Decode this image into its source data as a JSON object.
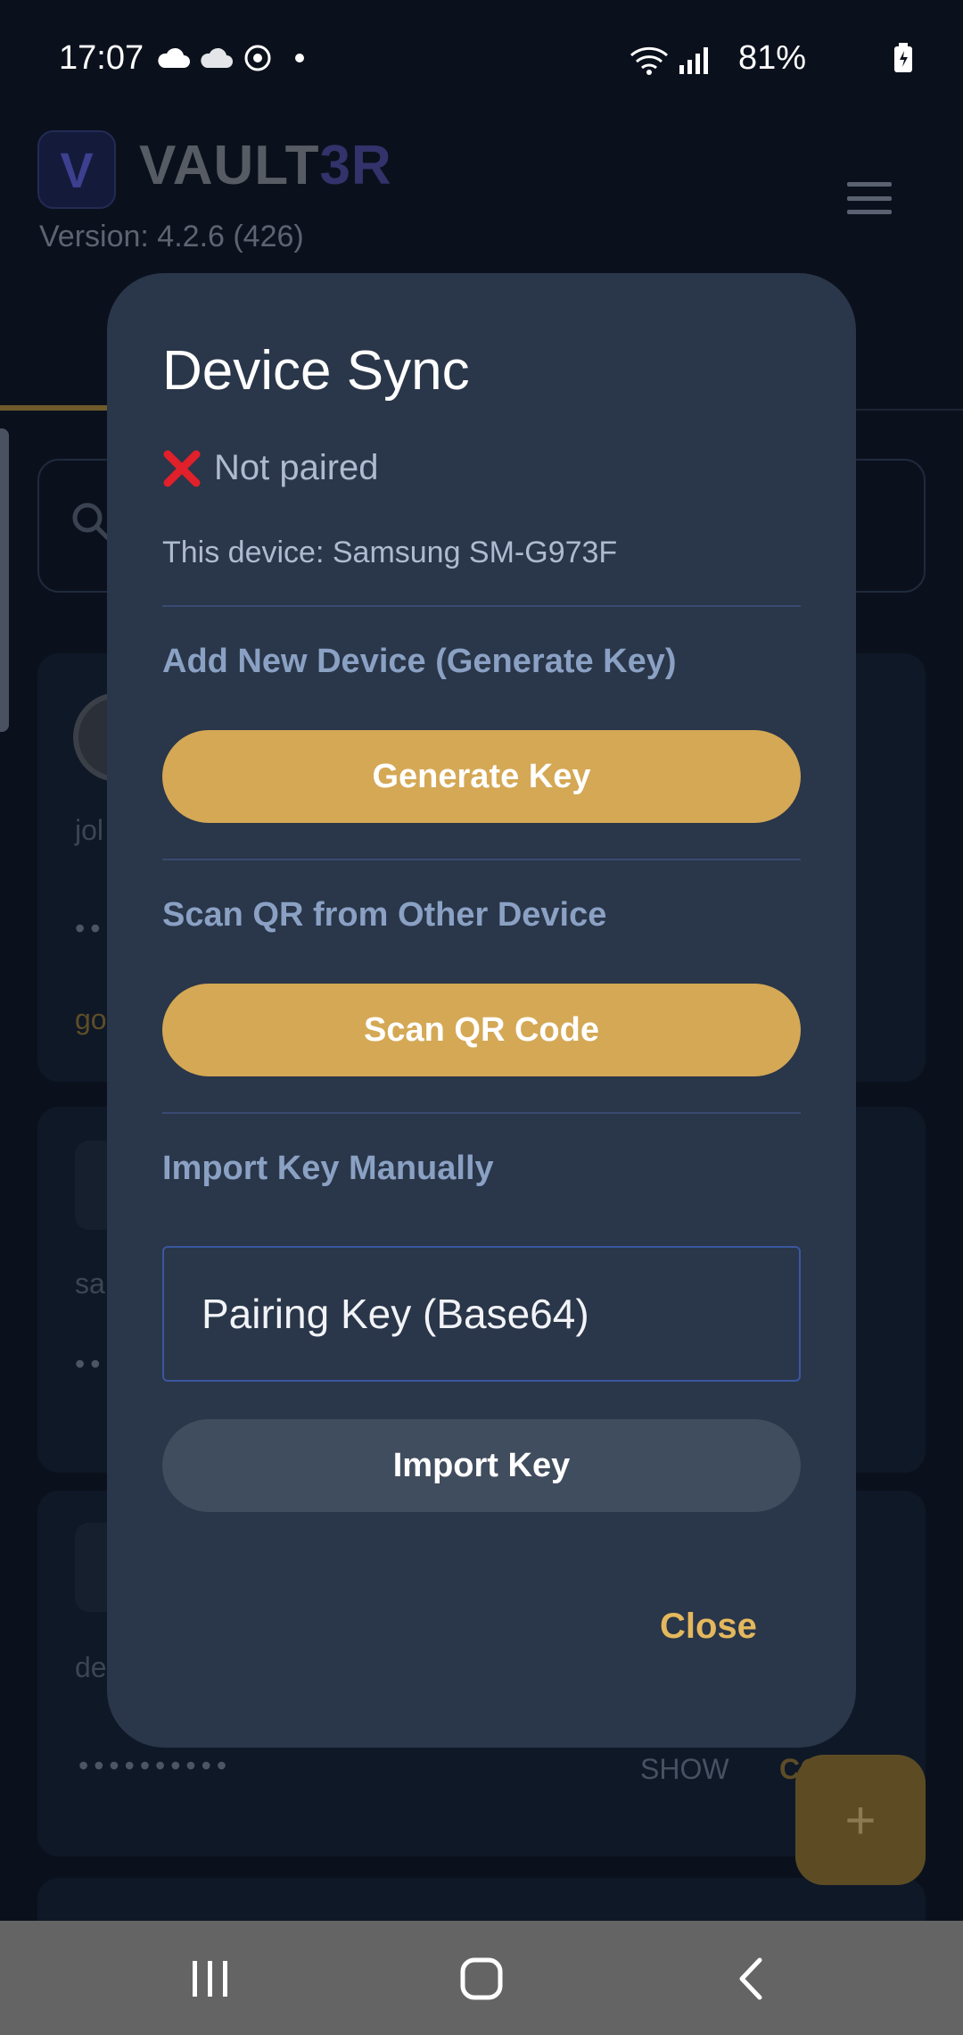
{
  "status_bar": {
    "time": "17:07",
    "battery": "81%",
    "icons_left": [
      "cloud-icon",
      "cloud-icon",
      "sync-icon",
      "dot-icon"
    ],
    "icons_right": [
      "wifi-icon",
      "signal-icon",
      "battery-icon"
    ]
  },
  "app": {
    "logo_letter": "V",
    "title_main": "VAULT",
    "title_accent": "3R",
    "version": "Version: 4.2.6 (426)"
  },
  "background_cards": [
    {
      "sub_text": "jol",
      "link_text": "go"
    },
    {
      "sub_text": "sa"
    },
    {
      "sub_text": "de",
      "dots": "••••••••••",
      "show_label": "SHOW",
      "copy_label": "CO"
    }
  ],
  "fab": {
    "label": "+"
  },
  "dialog": {
    "title": "Device Sync",
    "status_text": "Not paired",
    "device_info": "This device: Samsung SM-G973F",
    "generate_section_title": "Add New Device (Generate Key)",
    "generate_button": "Generate Key",
    "scan_section_title": "Scan QR from Other Device",
    "scan_button": "Scan QR Code",
    "import_section_title": "Import Key Manually",
    "key_input_placeholder": "Pairing Key (Base64)",
    "import_button": "Import Key",
    "close_button": "Close"
  },
  "colors": {
    "dialog_bg": "#2a3649",
    "accent_gold": "#d4a855",
    "close_text": "#e4b85d",
    "error_red": "#e0202a"
  },
  "nav_bar": [
    "recents-icon",
    "home-icon",
    "back-icon"
  ]
}
